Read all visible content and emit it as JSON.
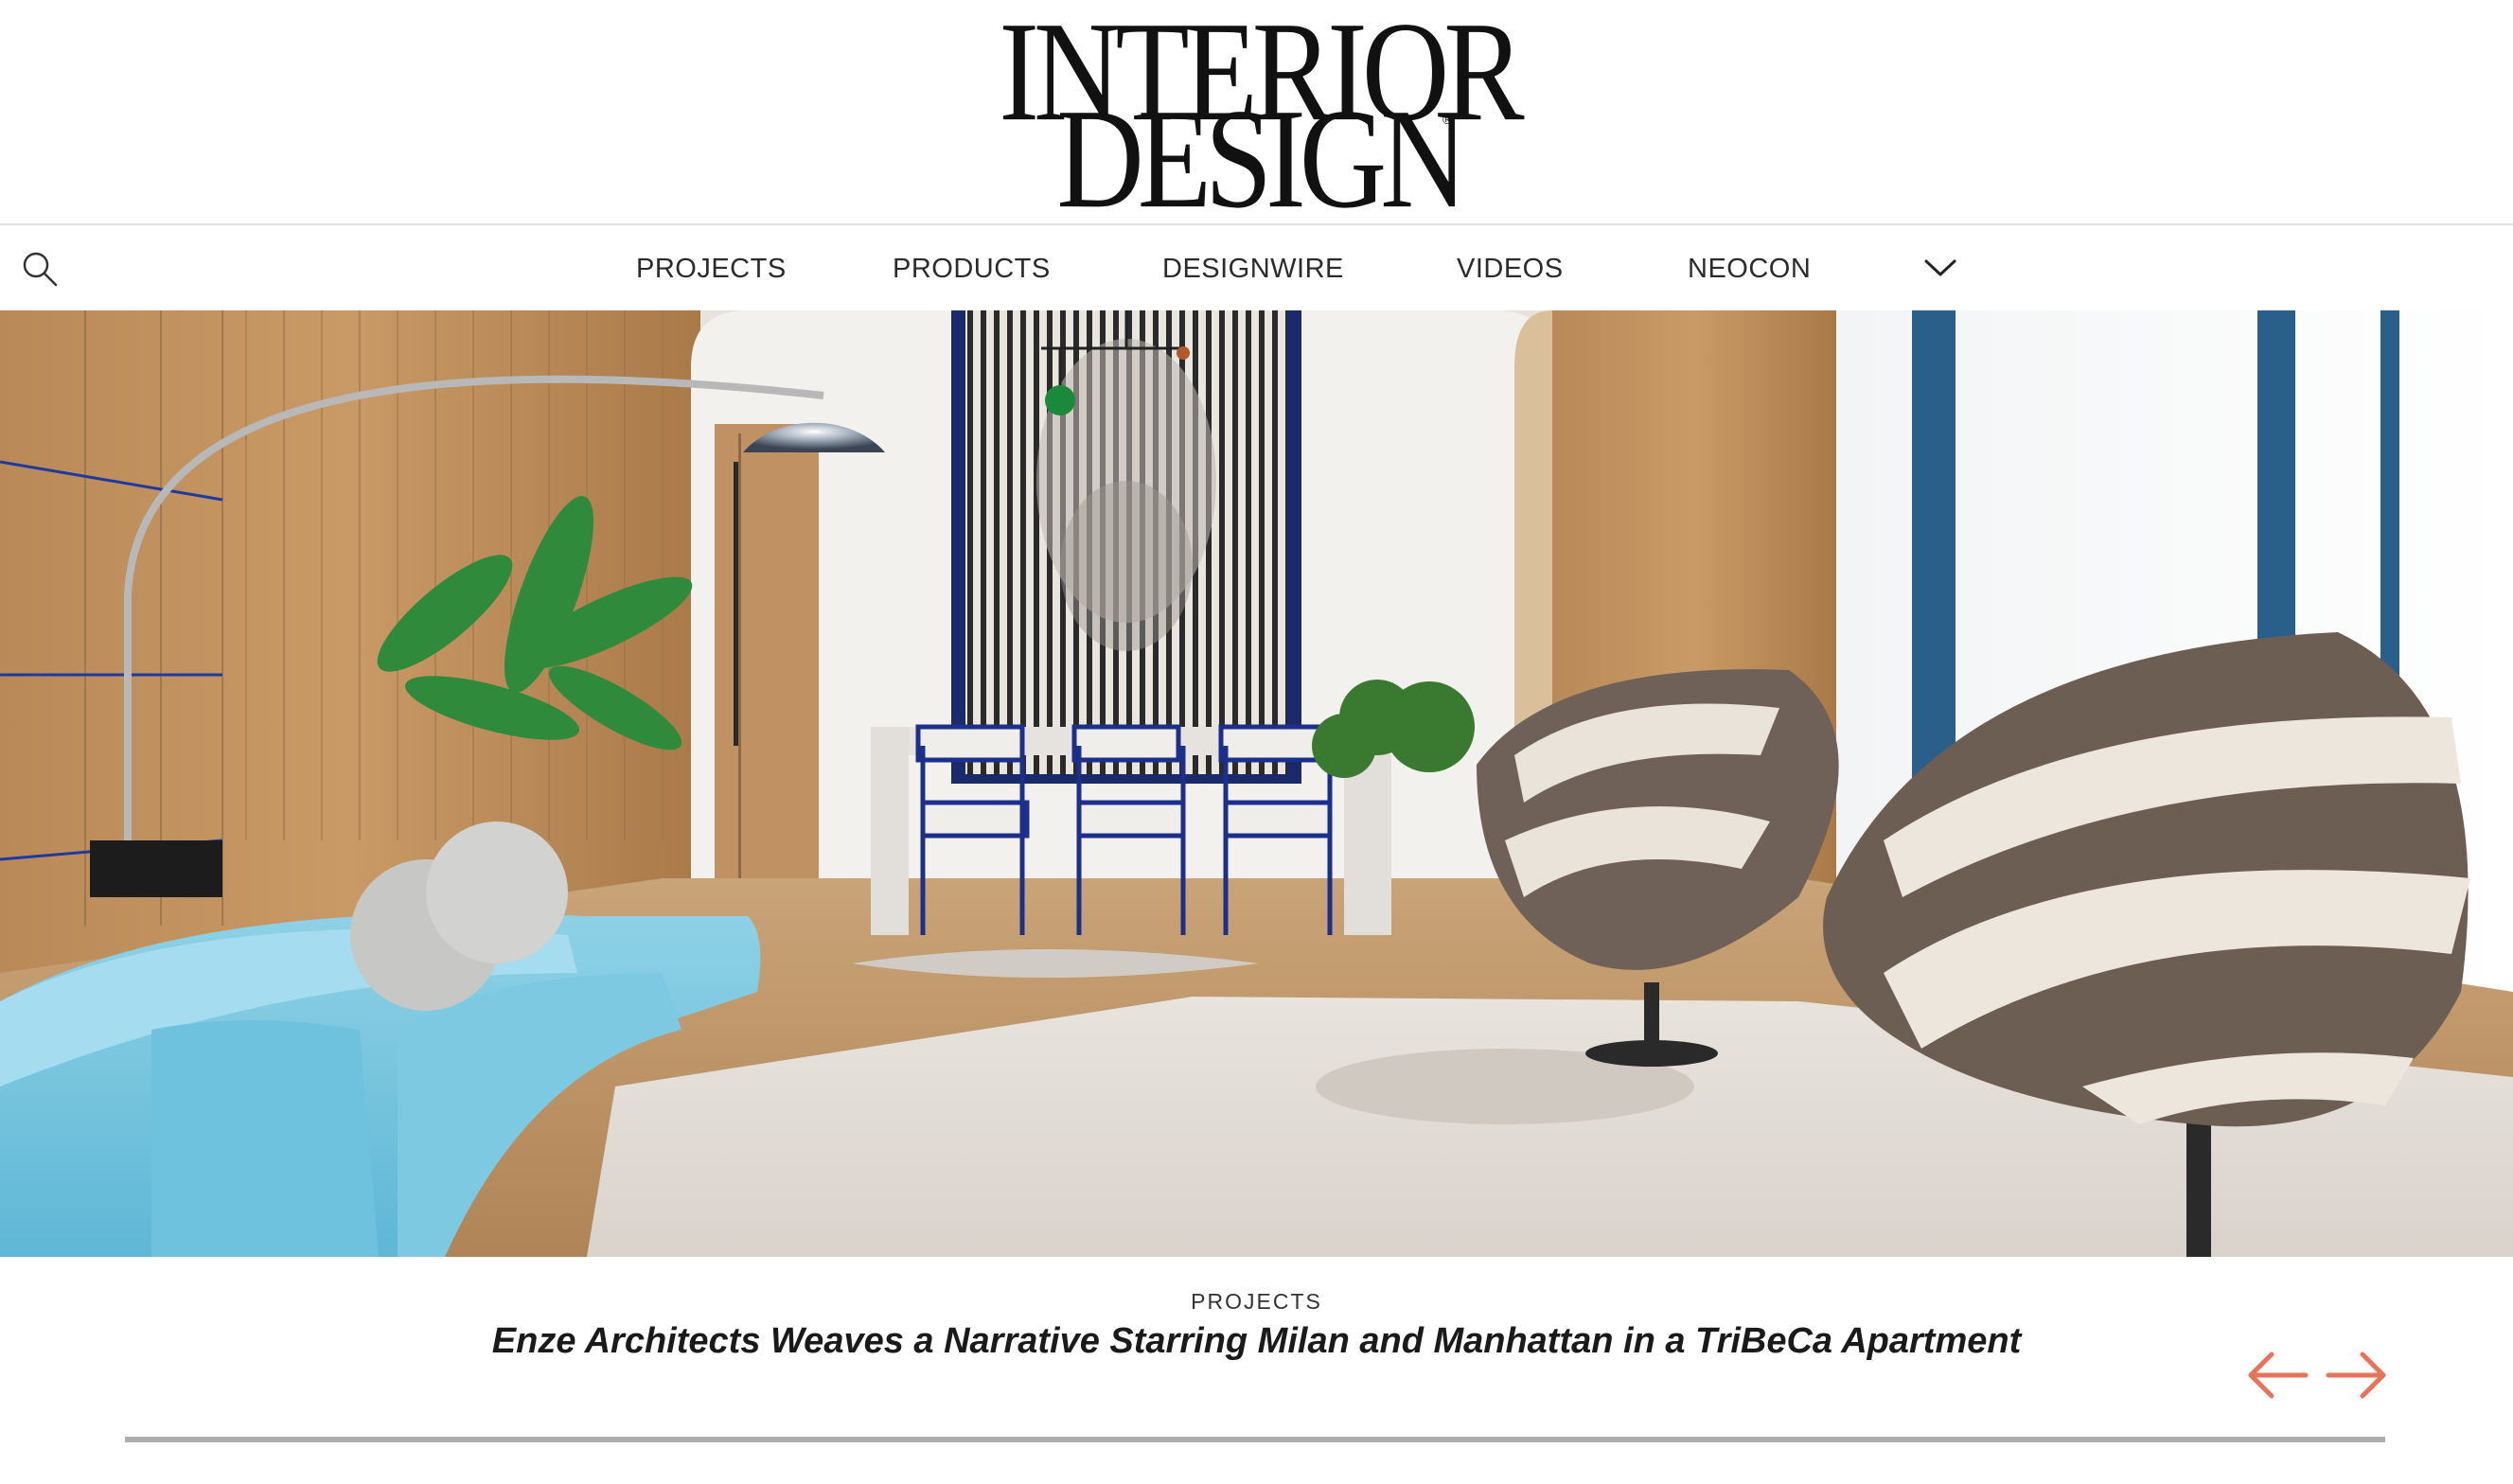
{
  "brand": {
    "line1": "INTERIOR",
    "line2": "DESIGN",
    "registered": "®"
  },
  "nav": {
    "search_icon": "search-icon",
    "items": [
      {
        "label": "PROJECTS"
      },
      {
        "label": "PRODUCTS"
      },
      {
        "label": "DESIGNWIRE"
      },
      {
        "label": "VIDEOS"
      },
      {
        "label": "NEOCON"
      }
    ],
    "more_icon": "chevron-down-icon"
  },
  "hero": {
    "kicker": "PROJECTS",
    "headline": "Enze Architects Weaves a Narrative Starring Milan and Manhattan in a TriBeCa Apartment",
    "prev_icon": "arrow-left-icon",
    "next_icon": "arrow-right-icon",
    "arrow_color": "#e8735a"
  }
}
